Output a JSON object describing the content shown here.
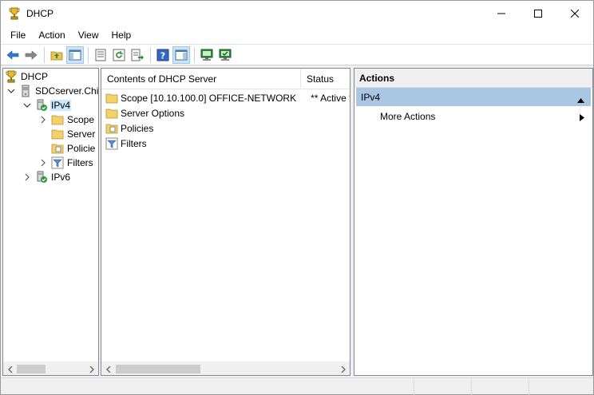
{
  "window": {
    "title": "DHCP",
    "app_icon": "dhcp-trophy-icon",
    "controls": [
      "minimize",
      "maximize",
      "close"
    ]
  },
  "menu": {
    "items": [
      "File",
      "Action",
      "View",
      "Help"
    ]
  },
  "toolbar": {
    "buttons": [
      "back-arrow-icon",
      "forward-arrow-icon",
      "up-folder-icon",
      "show-hide-tree-icon",
      "properties-icon",
      "refresh-icon",
      "export-list-icon",
      "help-icon",
      "show-hide-action-pane-icon",
      "display-statistics-icon",
      "authorize-server-icon"
    ]
  },
  "tree": {
    "items": [
      {
        "label": "DHCP",
        "icon": "dhcp-trophy-icon"
      },
      {
        "label": "SDCserver.Chi",
        "icon": "server-icon"
      },
      {
        "label": "IPv4",
        "icon": "ipv4-green-check-icon"
      },
      {
        "label": "Scope",
        "icon": "folder-icon"
      },
      {
        "label": "Server",
        "icon": "folder-icon"
      },
      {
        "label": "Policie",
        "icon": "folder-policy-icon"
      },
      {
        "label": "Filters",
        "icon": "filter-icon"
      },
      {
        "label": "IPv6",
        "icon": "ipv6-green-check-icon"
      }
    ]
  },
  "list": {
    "columns": {
      "name": "Contents of DHCP Server",
      "status": "Status"
    },
    "rows": [
      {
        "name": "Scope [10.10.100.0] OFFICE-NETWORK",
        "status": "** Active *",
        "icon": "folder-icon"
      },
      {
        "name": "Server Options",
        "status": "",
        "icon": "folder-icon"
      },
      {
        "name": "Policies",
        "status": "",
        "icon": "folder-policy-icon"
      },
      {
        "name": "Filters",
        "status": "",
        "icon": "filter-icon"
      }
    ]
  },
  "actions": {
    "header": "Actions",
    "group": "IPv4",
    "items": [
      "More Actions"
    ]
  },
  "colors": {
    "selection": "#cce8ff",
    "actions_group_bg": "#a9c7e2",
    "window_bg": "#f0f0f0"
  }
}
